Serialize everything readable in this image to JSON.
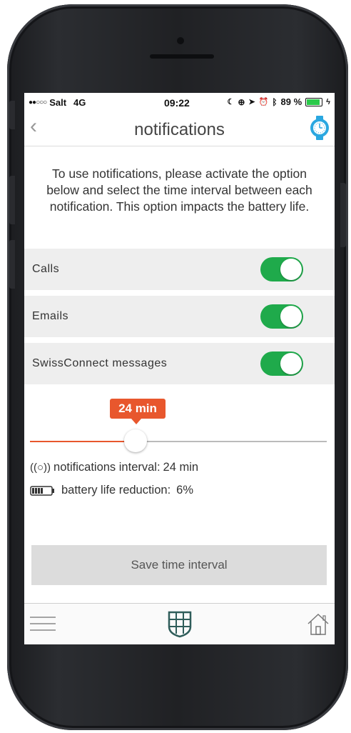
{
  "status_bar": {
    "carrier": "Salt",
    "network": "4G",
    "time": "09:22",
    "battery_percent": "89 %"
  },
  "nav": {
    "title": "notifications"
  },
  "intro_text": "To use notifications, please activate the option below and select the time interval between each notification. This option impacts the battery life.",
  "toggles": [
    {
      "label": "Calls",
      "on": true
    },
    {
      "label": "Emails",
      "on": true
    },
    {
      "label": "SwissConnect messages",
      "on": true
    }
  ],
  "slider": {
    "bubble_label": "24 min",
    "value_fraction": 0.35
  },
  "info": {
    "interval_label": "notifications interval:",
    "interval_value": "24 min",
    "battery_label": "battery life reduction:",
    "battery_value": "6%"
  },
  "save_button": "Save time interval",
  "colors": {
    "toggle_on": "#1faa4b",
    "slider_accent": "#e8572d",
    "watch_icon": "#2aa7e0",
    "crest": "#2f5d5a"
  }
}
